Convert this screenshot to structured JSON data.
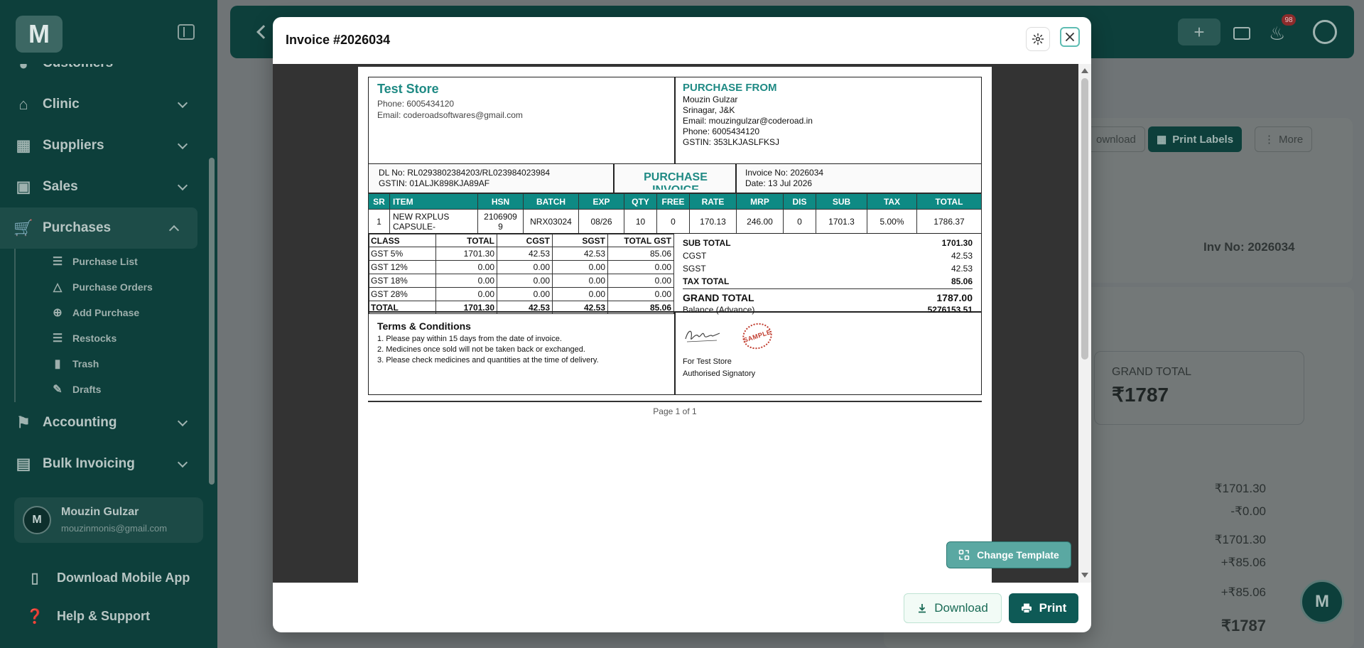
{
  "sidebar": {
    "logo": "M",
    "items": [
      {
        "label": "Customers"
      },
      {
        "label": "Clinic"
      },
      {
        "label": "Suppliers"
      },
      {
        "label": "Sales"
      },
      {
        "label": "Purchases"
      },
      {
        "label": "Accounting"
      },
      {
        "label": "Bulk Invoicing"
      }
    ],
    "purchase_sub": [
      {
        "label": "Purchase List"
      },
      {
        "label": "Purchase Orders"
      },
      {
        "label": "Add Purchase"
      },
      {
        "label": "Restocks"
      },
      {
        "label": "Trash"
      },
      {
        "label": "Drafts"
      }
    ],
    "user": {
      "initial": "M",
      "name": "Mouzin Gulzar",
      "email": "mouzinmonis@gmail.com"
    },
    "download_app": "Download Mobile App",
    "help": "Help & Support"
  },
  "topbar": {
    "notif_count": "98"
  },
  "background": {
    "download_label": "ownload",
    "print_labels": "Print Labels",
    "more": "More",
    "inv_no": "Inv No: 2026034",
    "grand_total_label": "GRAND TOTAL",
    "grand_total_value": "₹1787",
    "amounts": [
      "₹1701.30",
      "-₹0.00",
      "₹1701.30",
      "+₹85.06",
      "+₹85.06",
      "₹1787"
    ]
  },
  "modal": {
    "title": "Invoice #2026034",
    "change_template": "Change Template",
    "download": "Download",
    "print": "Print"
  },
  "invoice": {
    "store_name": "Test Store",
    "store_phone": "Phone: 6005434120",
    "store_email": "Email: coderoadsoftwares@gmail.com",
    "from_heading": "PURCHASE FROM",
    "from_name": "Mouzin Gulzar",
    "from_address": "Srinagar, J&K",
    "from_email": "Email: mouzingulzar@coderoad.in",
    "from_phone": "Phone: 6005434120",
    "from_gstin": "GSTIN: 353LKJASLFKSJ",
    "dl_no": "DL No: RL0293802384203/RL023984023984",
    "gstin": "GSTIN: 01ALJK898KJA89AF",
    "doc_title": "PURCHASE INVOICE",
    "invoice_no": "Invoice No: 2026034",
    "date": "Date: 13 Jul 2026",
    "item_headers": [
      "SR",
      "ITEM",
      "HSN",
      "BATCH",
      "EXP",
      "QTY",
      "FREE",
      "RATE",
      "MRP",
      "DIS",
      "SUB",
      "TAX",
      "TOTAL"
    ],
    "items": [
      {
        "sr": "1",
        "item": "NEW RXPLUS CAPSULE-",
        "hsn": "21069099",
        "batch": "NRX03024",
        "exp": "08/26",
        "qty": "10",
        "free": "0",
        "rate": "170.13",
        "mrp": "246.00",
        "dis": "0",
        "sub": "1701.3",
        "tax": "5.00%",
        "total": "1786.37"
      }
    ],
    "gst_headers": [
      "CLASS",
      "TOTAL",
      "CGST",
      "SGST",
      "TOTAL GST"
    ],
    "gst_rows": [
      {
        "cls": "GST 5%",
        "total": "1701.30",
        "cgst": "42.53",
        "sgst": "42.53",
        "tgst": "85.06"
      },
      {
        "cls": "GST 12%",
        "total": "0.00",
        "cgst": "0.00",
        "sgst": "0.00",
        "tgst": "0.00"
      },
      {
        "cls": "GST 18%",
        "total": "0.00",
        "cgst": "0.00",
        "sgst": "0.00",
        "tgst": "0.00"
      },
      {
        "cls": "GST 28%",
        "total": "0.00",
        "cgst": "0.00",
        "sgst": "0.00",
        "tgst": "0.00"
      },
      {
        "cls": "TOTAL",
        "total": "1701.30",
        "cgst": "42.53",
        "sgst": "42.53",
        "tgst": "85.06"
      }
    ],
    "summary": [
      {
        "label": "SUB TOTAL",
        "value": "1701.30"
      },
      {
        "label": "CGST",
        "value": "42.53"
      },
      {
        "label": "SGST",
        "value": "42.53"
      },
      {
        "label": "TAX TOTAL",
        "value": "85.06"
      }
    ],
    "grand_total_label": "GRAND TOTAL",
    "grand_total_value": "1787.00",
    "balance_label": "Balance (Advance)",
    "balance_value": "5276153.51",
    "terms_heading": "Terms & Conditions",
    "terms": [
      "1. Please pay within 15 days from the date of invoice.",
      "2. Medicines once sold will not be taken back or exchanged.",
      "3. Please check medicines and quantities at the time of delivery."
    ],
    "stamp_text": "SAMPLE",
    "for_store": "For Test Store",
    "signatory": "Authorised Signatory",
    "page": "Page 1 of 1"
  },
  "colors": {
    "accent": "#1f8a84",
    "header_bg": "#0e8a84",
    "sidebar_bg": "#0d3f3b",
    "print_btn": "#0e5a56"
  }
}
